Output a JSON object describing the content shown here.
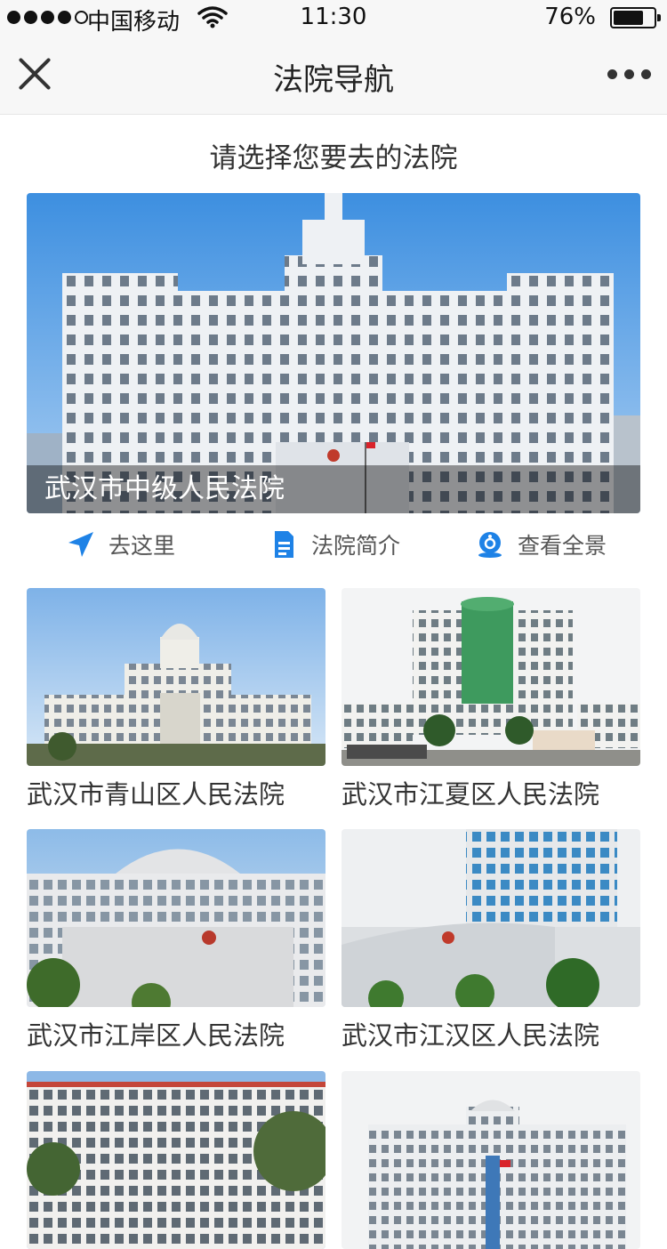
{
  "status_bar": {
    "carrier": "中国移动",
    "time": "11:30",
    "battery": "76%",
    "battery_level": 0.76
  },
  "navbar": {
    "title": "法院导航",
    "close_icon": "close-icon",
    "more_icon": "more-dots-icon"
  },
  "page": {
    "subtitle": "请选择您要去的法院"
  },
  "featured": {
    "name": "武汉市中级人民法院",
    "actions": [
      {
        "label": "去这里",
        "icon": "navigation-arrow-icon"
      },
      {
        "label": "法院简介",
        "icon": "document-icon"
      },
      {
        "label": "查看全景",
        "icon": "panorama-icon"
      }
    ]
  },
  "courts": [
    {
      "name": "武汉市青山区人民法院"
    },
    {
      "name": "武汉市江夏区人民法院"
    },
    {
      "name": "武汉市江岸区人民法院"
    },
    {
      "name": "武汉市江汉区人民法院"
    },
    {
      "name": ""
    },
    {
      "name": ""
    }
  ],
  "colors": {
    "accent": "#1e82e6",
    "bar_background": "#f7f7f7",
    "sky": "#4f9be4"
  }
}
